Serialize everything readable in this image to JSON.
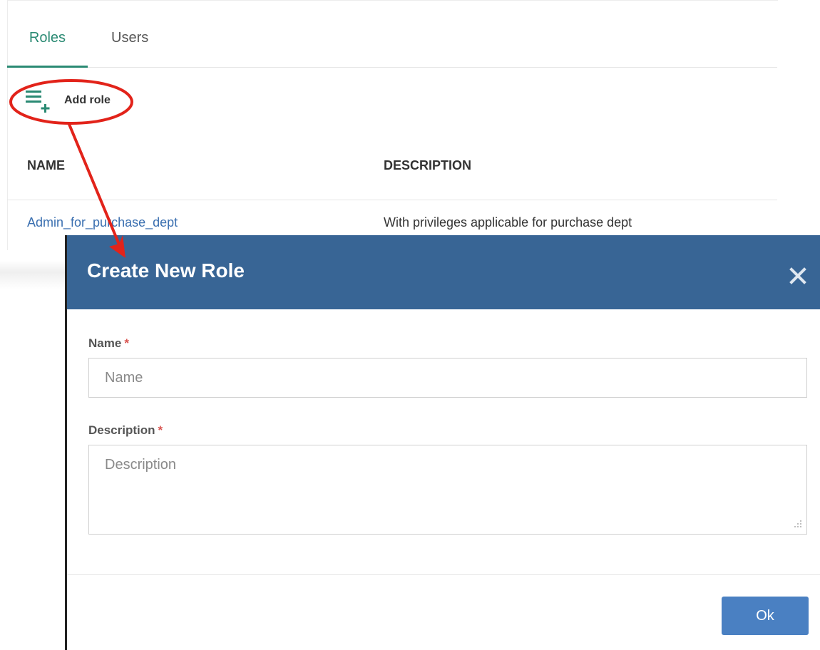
{
  "tabs": [
    {
      "label": "Roles",
      "active": true
    },
    {
      "label": "Users",
      "active": false
    }
  ],
  "toolbar": {
    "add_role_label": "Add role",
    "add_role_icon": "list-add-icon"
  },
  "table": {
    "columns": [
      "NAME",
      "DESCRIPTION"
    ],
    "rows": [
      {
        "name": "Admin_for_purchase_dept",
        "description": "With privileges applicable for purchase dept"
      }
    ]
  },
  "modal": {
    "title": "Create New Role",
    "close_icon": "close-icon",
    "fields": {
      "name": {
        "label": "Name",
        "required_mark": "*",
        "placeholder": "Name",
        "value": ""
      },
      "description": {
        "label": "Description",
        "required_mark": "*",
        "placeholder": "Description",
        "value": ""
      }
    },
    "ok_label": "Ok"
  },
  "colors": {
    "accent_green": "#2a8a73",
    "modal_header": "#386595",
    "ok_button": "#4a80c2",
    "link": "#3a6fb0",
    "annotation_red": "#e2231a"
  }
}
